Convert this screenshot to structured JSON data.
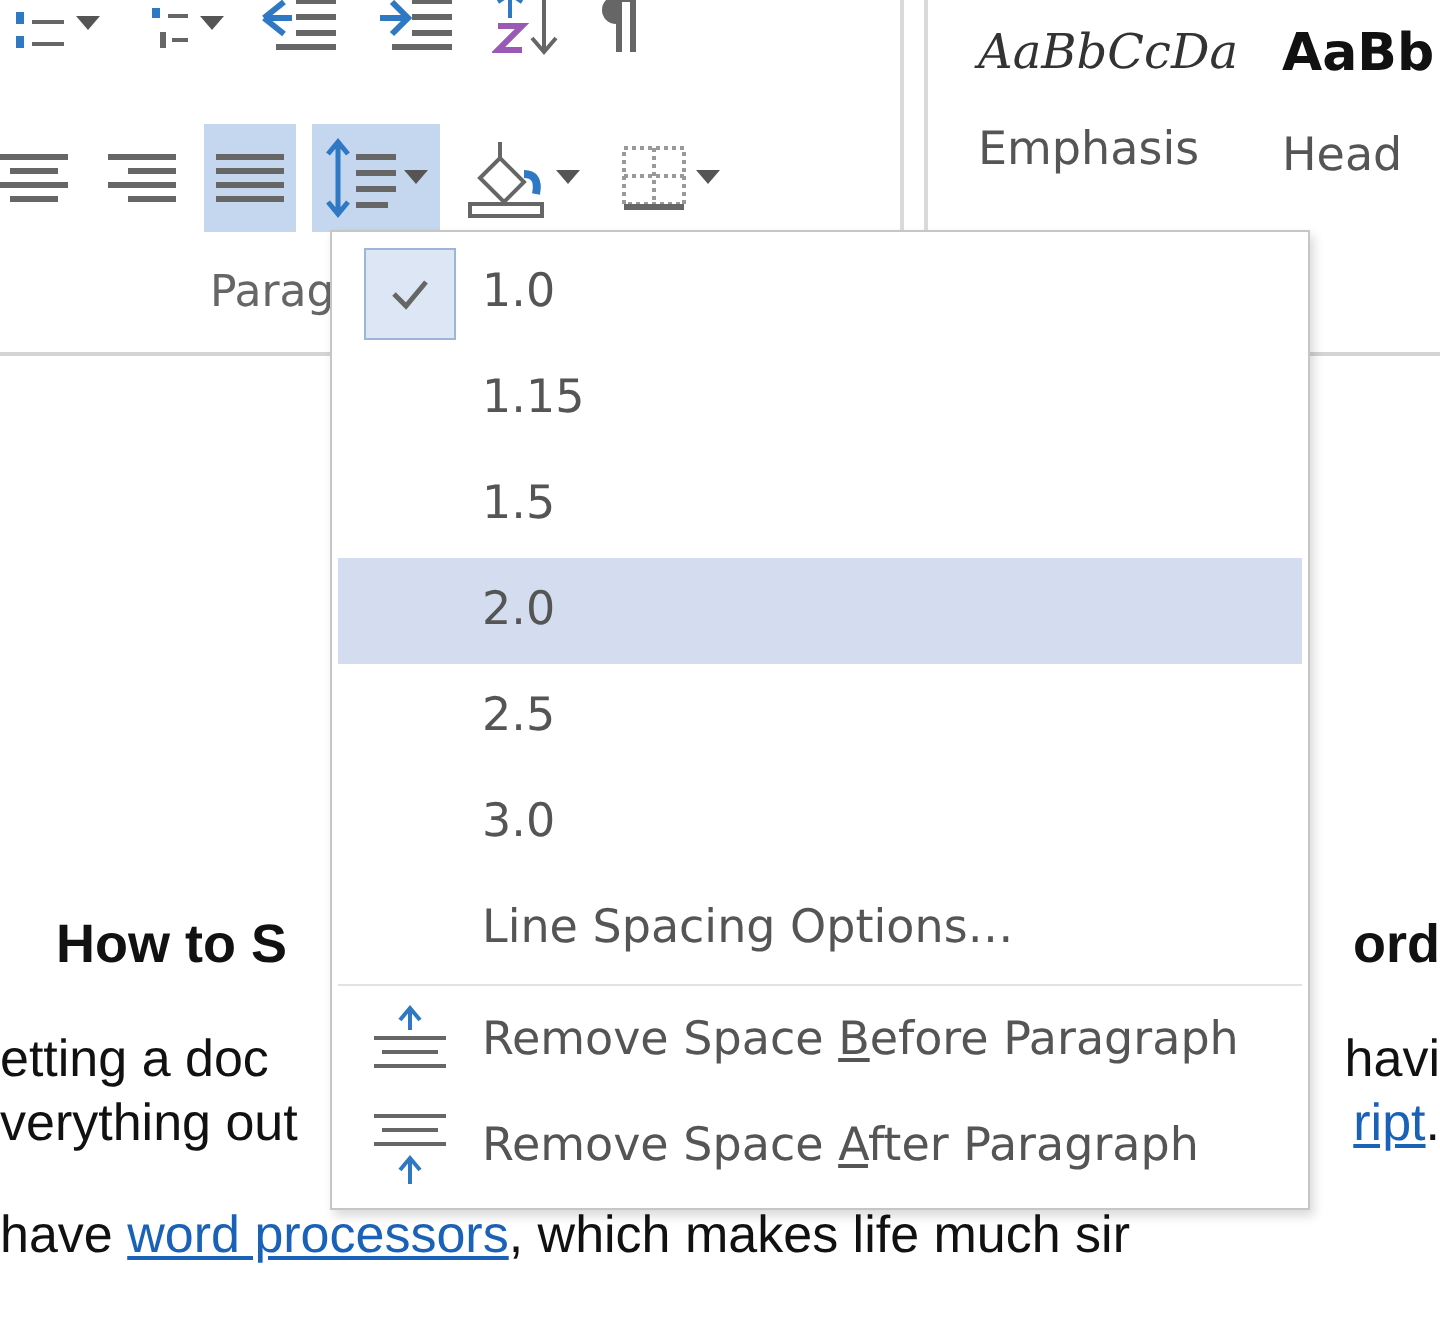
{
  "ribbon": {
    "row_1": [
      {
        "kind": "numbering",
        "dropdown": true
      },
      {
        "kind": "multilevel",
        "dropdown": true
      },
      {
        "kind": "decrease-indent",
        "dropdown": false
      },
      {
        "kind": "increase-indent",
        "dropdown": false
      },
      {
        "kind": "sort",
        "dropdown": false
      },
      {
        "kind": "pilcrow",
        "dropdown": false
      }
    ],
    "row_2": [
      {
        "kind": "align-center",
        "selected": false,
        "dropdown": false
      },
      {
        "kind": "align-right",
        "selected": false,
        "dropdown": false
      },
      {
        "kind": "justify",
        "selected": true,
        "dropdown": false
      },
      {
        "kind": "line-spacing",
        "selected": true,
        "dropdown": true
      },
      {
        "kind": "shading",
        "selected": false,
        "dropdown": true
      },
      {
        "kind": "borders",
        "selected": false,
        "dropdown": true
      }
    ],
    "group_label": "Parag",
    "styles": [
      {
        "kind": "emphasis",
        "sample": "AaBbCcDa",
        "name": "Emphasis"
      },
      {
        "kind": "heading",
        "sample": "AaBb",
        "name": "Head"
      }
    ]
  },
  "document": {
    "lines": [
      {
        "kind": "heading",
        "left": "How to S",
        "right": "ord"
      },
      {
        "kind": "text",
        "left": "etting a doc",
        "right": "havi"
      },
      {
        "kind": "text",
        "left": "verything out",
        "right_link": "ript",
        "right": "."
      },
      {
        "kind": "text",
        "left": "have ",
        "link": "word processors",
        "rest": ", which makes life much sir"
      }
    ]
  },
  "line_spacing_menu": {
    "items": [
      {
        "kind": "value",
        "label": "1.0",
        "checked": true,
        "selected": false
      },
      {
        "kind": "value",
        "label": "1.15",
        "checked": false,
        "selected": false
      },
      {
        "kind": "value",
        "label": "1.5",
        "checked": false,
        "selected": false
      },
      {
        "kind": "value",
        "label": "2.0",
        "checked": false,
        "selected": true
      },
      {
        "kind": "value",
        "label": "2.5",
        "checked": false,
        "selected": false
      },
      {
        "kind": "value",
        "label": "3.0",
        "checked": false,
        "selected": false
      },
      {
        "kind": "option",
        "label": "Line Spacing Options…",
        "selected": false
      },
      {
        "kind": "remove-before",
        "label_start": "Remove Space ",
        "access_key": "B",
        "label_end": "efore Paragraph",
        "selected": false
      },
      {
        "kind": "remove-after",
        "label_start": "Remove Space ",
        "access_key": "A",
        "label_end": "fter Paragraph",
        "selected": false
      }
    ]
  }
}
